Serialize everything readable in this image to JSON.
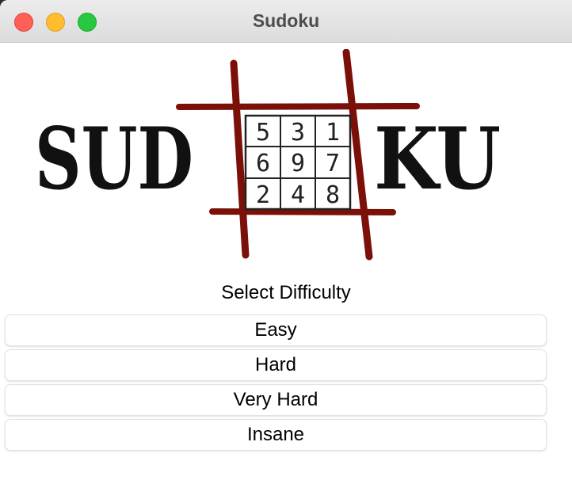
{
  "window": {
    "title": "Sudoku",
    "controls": {
      "close": "close-icon",
      "minimize": "minimize-icon",
      "zoom": "zoom-icon"
    }
  },
  "logo": {
    "left_text": "SUD",
    "right_text": "KU",
    "grid": [
      [
        "5",
        "3",
        "1"
      ],
      [
        "6",
        "9",
        "7"
      ],
      [
        "2",
        "4",
        "8"
      ]
    ],
    "colors": {
      "frame": "#7a1008",
      "ink": "#111111"
    }
  },
  "main": {
    "subtitle": "Select Difficulty",
    "buttons": [
      "Easy",
      "Hard",
      "Very Hard",
      "Insane"
    ]
  }
}
